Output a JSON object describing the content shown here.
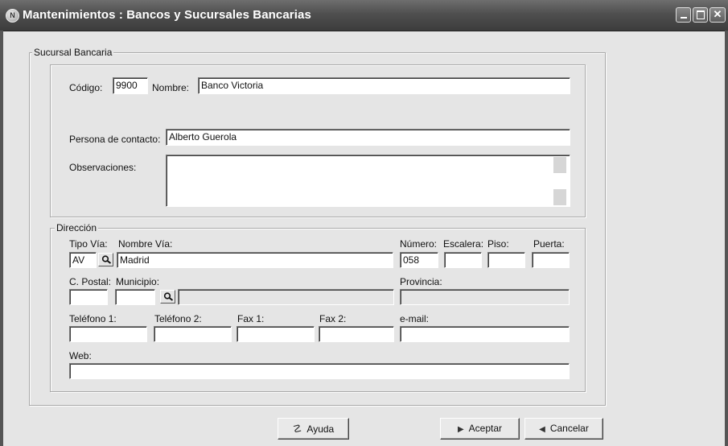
{
  "window": {
    "title": "Mantenimientos : Bancos y Sucursales Bancarias",
    "app_icon_glyph": "N"
  },
  "sucursal": {
    "legend": "Sucursal Bancaria",
    "codigo_label": "Código:",
    "codigo_value": "9900",
    "nombre_label": "Nombre:",
    "nombre_value": "Banco Victoria",
    "contacto_label": "Persona de contacto:",
    "contacto_value": "Alberto Guerola",
    "observaciones_label": "Observaciones:",
    "observaciones_value": ""
  },
  "direccion": {
    "legend": "Dirección",
    "tipo_via_label": "Tipo Vía:",
    "tipo_via_value": "AV",
    "nombre_via_label": "Nombre Vía:",
    "nombre_via_value": "Madrid",
    "numero_label": "Número:",
    "numero_value": "058",
    "escalera_label": "Escalera:",
    "piso_label": "Piso:",
    "puerta_label": "Puerta:",
    "cpostal_label": "C. Postal:",
    "municipio_label": "Municipio:",
    "provincia_label": "Provincia:",
    "telefono1_label": "Teléfono 1:",
    "telefono2_label": "Teléfono 2:",
    "fax1_label": "Fax 1:",
    "fax2_label": "Fax 2:",
    "email_label": "e-mail:",
    "web_label": "Web:"
  },
  "buttons": {
    "ayuda": "Ayuda",
    "aceptar": "Aceptar",
    "cancelar": "Cancelar"
  },
  "icons": {
    "app": "app-logo-icon",
    "lookup": "magnifier-icon",
    "help": "help-icon",
    "accept": "play-arrow-icon",
    "cancel": "back-arrow-icon"
  }
}
